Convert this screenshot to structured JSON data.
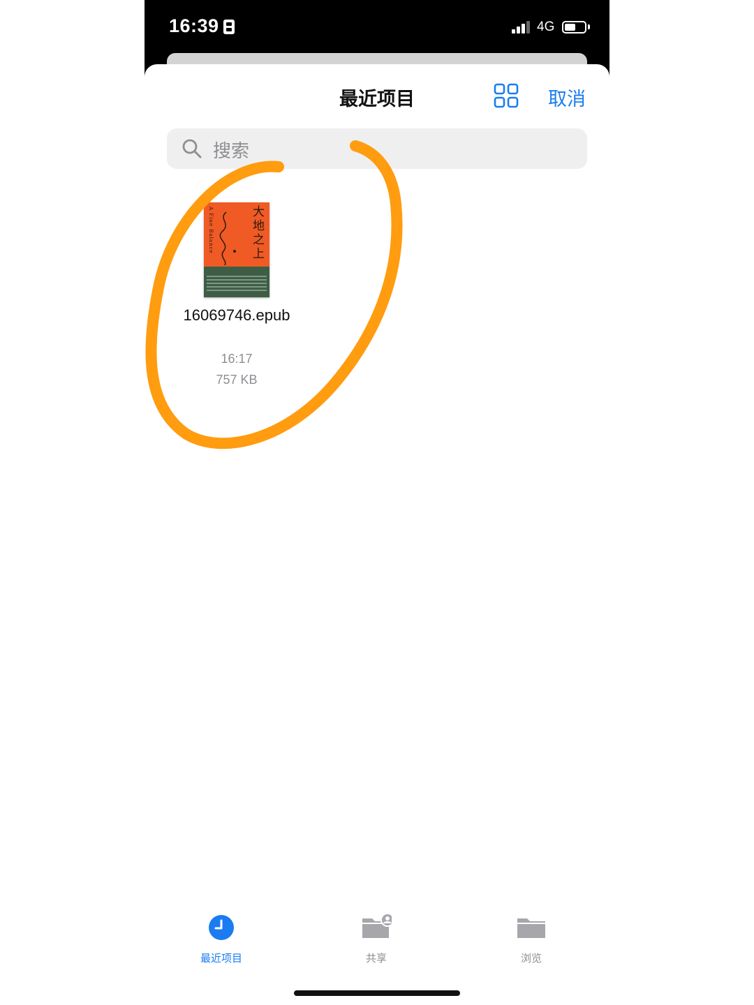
{
  "status_bar": {
    "time": "16:39",
    "network": "4G",
    "signal_bars_active": 3,
    "battery_level": 0.55
  },
  "sheet": {
    "title": "最近项目",
    "grid_icon": "grid-view-icon",
    "cancel_label": "取消"
  },
  "search": {
    "placeholder": "搜索",
    "icon": "magnifier-icon"
  },
  "files": [
    {
      "name": "16069746.epub",
      "time": "16:17",
      "size": "757 KB",
      "cover": {
        "title": "大地之上",
        "subtitle": "A Fine Balance",
        "colors": {
          "top": "#f05a24",
          "bottom": "#3d5e45"
        }
      }
    }
  ],
  "annotation": {
    "color": "#ff9c0f",
    "shape": "hand-drawn circle around file"
  },
  "tabbar": {
    "tabs": [
      {
        "label": "最近项目",
        "icon": "clock-icon",
        "active": true
      },
      {
        "label": "共享",
        "icon": "shared-folder-icon",
        "active": false
      },
      {
        "label": "浏览",
        "icon": "folder-icon",
        "active": false
      }
    ]
  },
  "colors": {
    "accent": "#1a7cf0",
    "secondary_text": "#8e8e93",
    "tab_inactive_icon": "#a6a6ab"
  }
}
